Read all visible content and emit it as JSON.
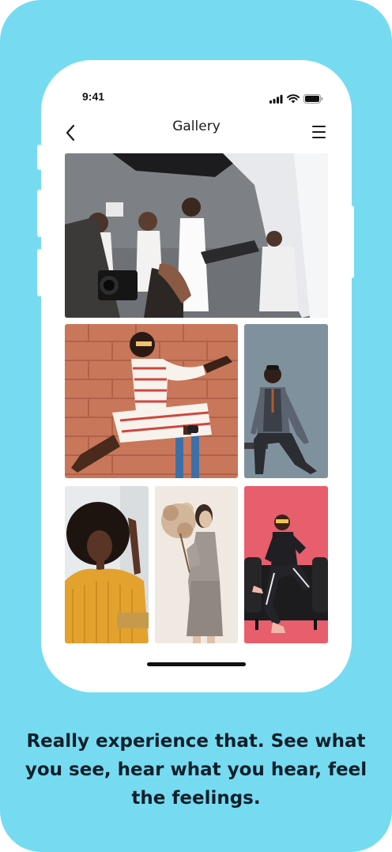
{
  "status_bar": {
    "time": "9:41",
    "icons": [
      "cellular-signal-icon",
      "wifi-icon",
      "battery-icon"
    ]
  },
  "nav": {
    "title": "Gallery",
    "back_icon": "chevron-left-icon",
    "menu_icon": "hamburger-menu-icon"
  },
  "gallery": {
    "photos": [
      "studio-photoshoot-photo",
      "striped-dress-brick-wall-photo",
      "man-in-vest-photo",
      "woman-afro-yellow-sweater-photo",
      "woman-with-dried-flowers-photo",
      "woman-on-black-sofa-photo"
    ]
  },
  "tagline": "Really experience that. See what you see, hear what you hear, feel the feelings.",
  "colors": {
    "background": "#76dbf1",
    "phone": "#ffffff",
    "text": "#0f1f2a"
  }
}
